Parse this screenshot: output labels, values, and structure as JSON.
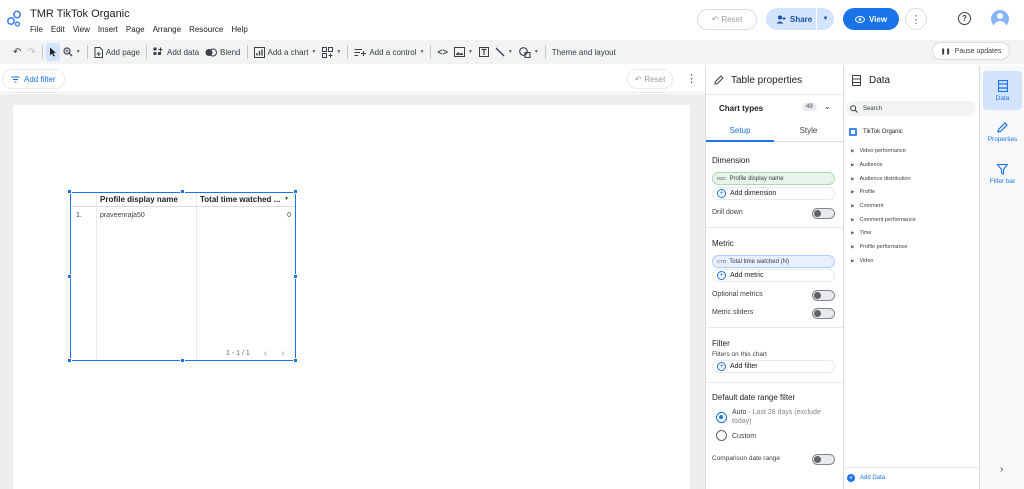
{
  "app": {
    "title": "TMR TikTok Organic",
    "menu": [
      "File",
      "Edit",
      "View",
      "Insert",
      "Page",
      "Arrange",
      "Resource",
      "Help"
    ]
  },
  "header": {
    "reset_label": "Reset",
    "share_label": "Share",
    "view_label": "View"
  },
  "toolbar": {
    "add_page": "Add page",
    "add_data": "Add data",
    "blend": "Blend",
    "add_chart": "Add a chart",
    "add_control": "Add a control",
    "theme_layout": "Theme and layout",
    "pause_updates": "Pause updates"
  },
  "filterbar": {
    "add_filter": "Add filter",
    "reset": "Reset"
  },
  "table": {
    "col1_header": "Profile display name",
    "col2_header": "Total time watched ...",
    "rows": [
      {
        "index": "1.",
        "name": "praveenraja50",
        "value": "0"
      }
    ],
    "pager": "1 - 1 / 1"
  },
  "properties": {
    "title": "Table properties",
    "chart_types_label": "Chart types",
    "chart_types_count": "49",
    "tab_setup": "Setup",
    "tab_style": "Style",
    "dimension_heading": "Dimension",
    "dimension_chip_type": "RBC",
    "dimension_chip": "Profile display name",
    "add_dimension": "Add dimension",
    "drill_down": "Drill down",
    "metric_heading": "Metric",
    "metric_chip_type": "CTD",
    "metric_chip": "Total time watched (N)",
    "add_metric": "Add metric",
    "optional_metrics": "Optional metrics",
    "metric_sliders": "Metric sliders",
    "filter_heading": "Filter",
    "filters_on_chart": "Filters on this chart",
    "add_filter": "Add filter",
    "date_range_heading": "Default date range filter",
    "auto_label": "Auto",
    "auto_detail": "Last 28 days (exclude today)",
    "custom_label": "Custom",
    "comparison_label": "Comparison date range"
  },
  "data_panel": {
    "title": "Data",
    "search_placeholder": "Search",
    "source": "TikTok Organic",
    "groups": [
      "Video performance",
      "Audience",
      "Audience distribution",
      "Profile",
      "Comment",
      "Comment performance",
      "Time",
      "Profile performance",
      "Video"
    ],
    "add_data": "Add Data"
  },
  "rail": {
    "data": "Data",
    "properties": "Properties",
    "filter_bar": "Filter bar"
  },
  "colors": {
    "accent": "#1a73e8",
    "dimension_chip": "#e6f4ea",
    "metric_chip": "#e8f0fe"
  }
}
